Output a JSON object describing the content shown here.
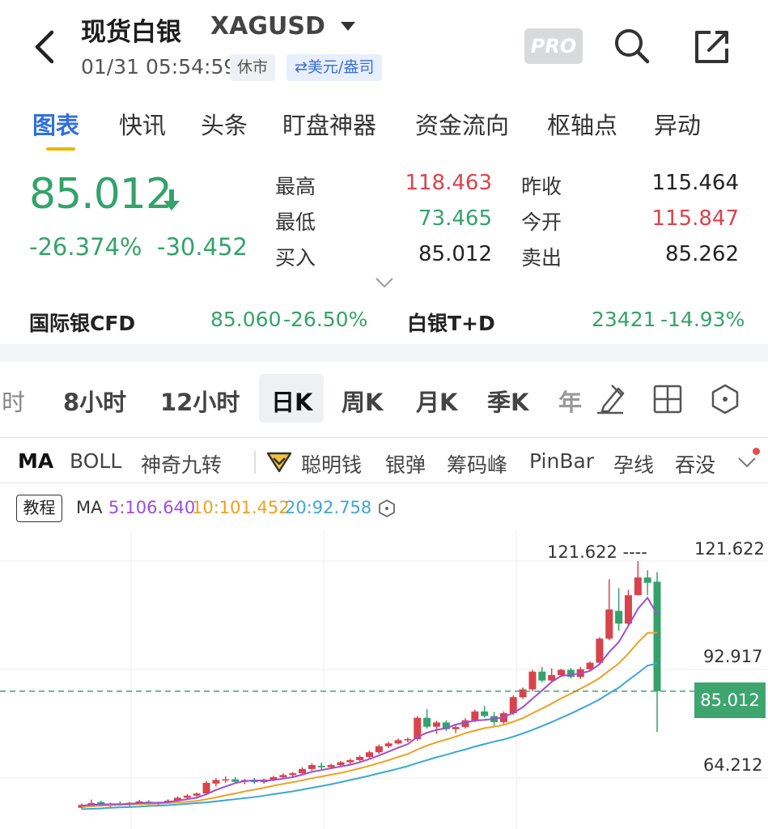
{
  "header": {
    "title": "现货白银",
    "symbol": "XAGUSD",
    "time": "01/31 05:54:59",
    "status_badge": "休市",
    "unit_badge": "⇄美元/盎司",
    "pro_label": "PRO"
  },
  "tabs": [
    "图表",
    "快讯",
    "头条",
    "盯盘神器",
    "资金流向",
    "枢轴点",
    "异动"
  ],
  "quote": {
    "price": "85.012",
    "change_pct": "-26.374%",
    "change": "-30.452",
    "high_label": "最高",
    "high": "118.463",
    "low_label": "最低",
    "low": "73.465",
    "bid_label": "买入",
    "bid": "85.012",
    "prev_close_label": "昨收",
    "prev_close": "115.464",
    "open_label": "今开",
    "open": "115.847",
    "ask_label": "卖出",
    "ask": "85.262"
  },
  "related": {
    "cfd_label": "国际银CFD",
    "cfd_price": "85.060",
    "cfd_change": "-26.50%",
    "td_label": "白银T+D",
    "td_price": "23421",
    "td_change": "-14.93%"
  },
  "periods": [
    "时",
    "8小时",
    "12小时",
    "日K",
    "周K",
    "月K",
    "季K",
    "年"
  ],
  "indicators": [
    "MA",
    "BOLL",
    "神奇九转",
    "聪明钱",
    "银弹",
    "筹码峰",
    "PinBar",
    "孕线",
    "吞没"
  ],
  "chart_header": {
    "tutorial": "教程",
    "ma_label": "MA",
    "ma5": "5:106.640",
    "ma10": "10:101.452",
    "ma20": "20:92.758"
  },
  "colors": {
    "up": "#d9434c",
    "down": "#33a36b",
    "accent": "#2f6fe4",
    "ma5": "#9b4fd6",
    "ma10": "#f0a020",
    "ma20": "#3aa7d8"
  },
  "chart_data": {
    "type": "candlestick",
    "y_axis_labels": [
      "121.622",
      "92.917",
      "85.012",
      "64.212"
    ],
    "max_marker": "121.622 ----",
    "last_price": "85.012",
    "ylim": [
      50,
      127
    ],
    "candles": [
      {
        "o": 52.2,
        "h": 53.4,
        "l": 51.8,
        "c": 53.0
      },
      {
        "o": 53.0,
        "h": 54.5,
        "l": 52.6,
        "c": 53.5
      },
      {
        "o": 53.8,
        "h": 54.2,
        "l": 52.5,
        "c": 52.9
      },
      {
        "o": 52.9,
        "h": 53.6,
        "l": 52.0,
        "c": 53.4
      },
      {
        "o": 53.4,
        "h": 54.0,
        "l": 52.8,
        "c": 53.0
      },
      {
        "o": 53.0,
        "h": 53.8,
        "l": 52.3,
        "c": 53.6
      },
      {
        "o": 53.6,
        "h": 54.4,
        "l": 53.2,
        "c": 54.0
      },
      {
        "o": 53.9,
        "h": 54.3,
        "l": 53.0,
        "c": 53.3
      },
      {
        "o": 53.3,
        "h": 53.9,
        "l": 52.8,
        "c": 53.7
      },
      {
        "o": 53.7,
        "h": 54.6,
        "l": 53.4,
        "c": 54.2
      },
      {
        "o": 54.2,
        "h": 55.4,
        "l": 53.9,
        "c": 55.0
      },
      {
        "o": 55.0,
        "h": 56.0,
        "l": 54.4,
        "c": 55.6
      },
      {
        "o": 55.6,
        "h": 56.5,
        "l": 55.0,
        "c": 56.2
      },
      {
        "o": 56.2,
        "h": 59.7,
        "l": 55.8,
        "c": 59.2
      },
      {
        "o": 59.0,
        "h": 60.5,
        "l": 58.2,
        "c": 60.0
      },
      {
        "o": 60.0,
        "h": 61.0,
        "l": 59.2,
        "c": 60.2
      },
      {
        "o": 60.2,
        "h": 60.8,
        "l": 59.0,
        "c": 59.5
      },
      {
        "o": 59.5,
        "h": 60.3,
        "l": 58.8,
        "c": 60.0
      },
      {
        "o": 60.0,
        "h": 60.6,
        "l": 58.9,
        "c": 59.4
      },
      {
        "o": 59.4,
        "h": 60.4,
        "l": 59.0,
        "c": 60.1
      },
      {
        "o": 60.1,
        "h": 61.2,
        "l": 59.7,
        "c": 60.8
      },
      {
        "o": 60.8,
        "h": 61.9,
        "l": 60.2,
        "c": 61.4
      },
      {
        "o": 61.4,
        "h": 62.3,
        "l": 60.9,
        "c": 61.9
      },
      {
        "o": 61.9,
        "h": 63.6,
        "l": 61.5,
        "c": 63.1
      },
      {
        "o": 63.1,
        "h": 64.7,
        "l": 62.6,
        "c": 64.2
      },
      {
        "o": 64.0,
        "h": 64.9,
        "l": 63.1,
        "c": 63.6
      },
      {
        "o": 63.6,
        "h": 64.6,
        "l": 63.1,
        "c": 64.2
      },
      {
        "o": 64.2,
        "h": 65.4,
        "l": 63.8,
        "c": 65.0
      },
      {
        "o": 65.0,
        "h": 66.0,
        "l": 64.5,
        "c": 65.6
      },
      {
        "o": 65.6,
        "h": 67.0,
        "l": 65.1,
        "c": 66.5
      },
      {
        "o": 66.5,
        "h": 68.3,
        "l": 66.0,
        "c": 67.8
      },
      {
        "o": 67.8,
        "h": 70.0,
        "l": 67.3,
        "c": 69.5
      },
      {
        "o": 69.5,
        "h": 70.8,
        "l": 69.0,
        "c": 70.3
      },
      {
        "o": 70.3,
        "h": 71.7,
        "l": 70.0,
        "c": 71.2
      },
      {
        "o": 71.2,
        "h": 72.0,
        "l": 70.6,
        "c": 71.5
      },
      {
        "o": 71.5,
        "h": 78.0,
        "l": 71.0,
        "c": 77.5
      },
      {
        "o": 77.5,
        "h": 80.0,
        "l": 74.5,
        "c": 75.0
      },
      {
        "o": 75.0,
        "h": 76.7,
        "l": 73.0,
        "c": 76.2
      },
      {
        "o": 76.2,
        "h": 76.8,
        "l": 73.8,
        "c": 74.3
      },
      {
        "o": 74.3,
        "h": 75.3,
        "l": 73.2,
        "c": 74.9
      },
      {
        "o": 74.9,
        "h": 77.4,
        "l": 74.5,
        "c": 76.8
      },
      {
        "o": 76.8,
        "h": 79.8,
        "l": 76.3,
        "c": 79.3
      },
      {
        "o": 79.3,
        "h": 80.8,
        "l": 77.6,
        "c": 78.0
      },
      {
        "o": 78.0,
        "h": 79.2,
        "l": 75.2,
        "c": 76.3
      },
      {
        "o": 76.3,
        "h": 79.3,
        "l": 75.8,
        "c": 78.8
      },
      {
        "o": 78.8,
        "h": 83.8,
        "l": 78.3,
        "c": 83.3
      },
      {
        "o": 83.3,
        "h": 86.0,
        "l": 82.8,
        "c": 85.5
      },
      {
        "o": 85.5,
        "h": 91.0,
        "l": 85.0,
        "c": 90.5
      },
      {
        "o": 90.5,
        "h": 91.8,
        "l": 87.5,
        "c": 88.0
      },
      {
        "o": 88.0,
        "h": 91.4,
        "l": 87.5,
        "c": 89.5
      },
      {
        "o": 89.5,
        "h": 91.3,
        "l": 89.0,
        "c": 91.0
      },
      {
        "o": 91.0,
        "h": 91.5,
        "l": 88.6,
        "c": 89.0
      },
      {
        "o": 89.0,
        "h": 91.8,
        "l": 88.5,
        "c": 91.2
      },
      {
        "o": 91.2,
        "h": 93.4,
        "l": 90.7,
        "c": 93.0
      },
      {
        "o": 93.0,
        "h": 100.2,
        "l": 92.5,
        "c": 99.8
      },
      {
        "o": 99.8,
        "h": 116.5,
        "l": 99.3,
        "c": 108.0
      },
      {
        "o": 107.6,
        "h": 114.0,
        "l": 102.0,
        "c": 104.0
      },
      {
        "o": 104.0,
        "h": 113.5,
        "l": 103.5,
        "c": 112.0
      },
      {
        "o": 112.0,
        "h": 121.6,
        "l": 112.0,
        "c": 117.0
      },
      {
        "o": 117.0,
        "h": 119.0,
        "l": 112.0,
        "c": 115.5
      },
      {
        "o": 115.8,
        "h": 118.5,
        "l": 73.5,
        "c": 85.0
      }
    ],
    "ma5": [
      52.8,
      53.0,
      53.1,
      53.2,
      53.2,
      53.3,
      53.5,
      53.6,
      53.6,
      53.8,
      54.2,
      54.6,
      55.0,
      56.0,
      57.2,
      58.2,
      59.1,
      59.7,
      59.9,
      59.8,
      60.0,
      60.4,
      60.8,
      61.5,
      62.3,
      62.8,
      63.3,
      63.8,
      64.3,
      65.0,
      65.9,
      66.9,
      68.0,
      69.1,
      70.1,
      72.1,
      73.3,
      74.1,
      74.6,
      75.6,
      76.2,
      76.7,
      76.9,
      77.2,
      77.7,
      78.9,
      80.5,
      82.9,
      85.2,
      87.6,
      89.3,
      89.6,
      90.0,
      90.7,
      92.6,
      96.0,
      98.8,
      103.4,
      108.2,
      111.3,
      106.6
    ],
    "ma10": [
      52.5,
      52.6,
      52.8,
      52.9,
      53.0,
      53.1,
      53.2,
      53.3,
      53.4,
      53.5,
      53.7,
      53.9,
      54.1,
      54.6,
      55.1,
      55.7,
      56.2,
      56.8,
      57.3,
      57.8,
      58.4,
      58.9,
      59.4,
      59.9,
      60.5,
      61.0,
      61.5,
      62.0,
      62.6,
      63.3,
      64.0,
      64.8,
      65.6,
      66.5,
      67.3,
      68.6,
      69.7,
      70.6,
      71.4,
      72.2,
      73.2,
      73.9,
      74.6,
      75.0,
      75.5,
      76.4,
      77.4,
      78.8,
      80.1,
      81.5,
      83.0,
      84.3,
      85.7,
      87.1,
      88.7,
      90.8,
      92.8,
      95.6,
      98.7,
      101.4,
      101.5
    ],
    "ma20": [
      51.8,
      51.9,
      52.0,
      52.2,
      52.3,
      52.4,
      52.5,
      52.7,
      52.8,
      52.9,
      53.1,
      53.3,
      53.5,
      53.7,
      54.0,
      54.3,
      54.6,
      54.9,
      55.2,
      55.6,
      56.0,
      56.4,
      56.8,
      57.3,
      57.8,
      58.3,
      58.8,
      59.4,
      60.0,
      60.6,
      61.2,
      61.9,
      62.5,
      63.2,
      63.9,
      64.8,
      65.6,
      66.4,
      67.1,
      67.9,
      68.6,
      69.4,
      70.1,
      70.8,
      71.4,
      72.2,
      73.1,
      74.1,
      75.2,
      76.3,
      77.5,
      78.7,
      80.0,
      81.3,
      82.7,
      84.4,
      86.0,
      88.1,
      90.1,
      92.2,
      92.8
    ]
  }
}
